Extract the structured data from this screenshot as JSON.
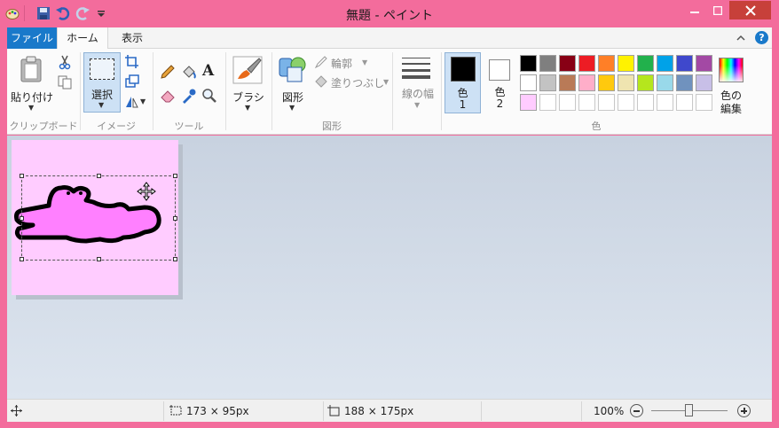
{
  "window": {
    "title": "無題 - ペイント"
  },
  "quick_access": {
    "icons": [
      "paint-app-icon",
      "save-icon",
      "undo-icon",
      "redo-icon",
      "customize-icon"
    ]
  },
  "tabs": {
    "file": "ファイル",
    "home": "ホーム",
    "view": "表示"
  },
  "ribbon": {
    "clipboard": {
      "paste": "貼り付け",
      "group": "クリップボード"
    },
    "image": {
      "select": "選択",
      "group": "イメージ"
    },
    "tools": {
      "group": "ツール"
    },
    "brush": {
      "label": "ブラシ"
    },
    "shapes": {
      "label": "図形",
      "outline": "輪郭",
      "fill": "塗りつぶし",
      "group": "図形"
    },
    "size": {
      "label": "線の幅"
    },
    "colors": {
      "color1": "色",
      "color1_num": "1",
      "color2": "色",
      "color2_num": "2",
      "edit_line1": "色の",
      "edit_line2": "編集",
      "group": "色",
      "primary": "#000000",
      "secondary": "#ffffff",
      "palette_row1": [
        "#000000",
        "#7f7f7f",
        "#880015",
        "#ed1c24",
        "#ff7f27",
        "#fff200",
        "#22b14c",
        "#00a2e8",
        "#3f48cc",
        "#a349a4"
      ],
      "palette_row2": [
        "#ffffff",
        "#c3c3c3",
        "#b97a57",
        "#ffaec9",
        "#ffc90e",
        "#efe4b0",
        "#b5e61d",
        "#99d9ea",
        "#7092be",
        "#c8bfe7"
      ],
      "palette_row3": [
        "#ffccff",
        "",
        "",
        "",
        "",
        "",
        "",
        "",
        "",
        ""
      ]
    }
  },
  "status": {
    "selection_size": "173 × 95px",
    "image_size": "188 × 175px",
    "zoom": "100%"
  },
  "canvas": {
    "background": "#ffccff",
    "fill": "#ff80ff"
  }
}
